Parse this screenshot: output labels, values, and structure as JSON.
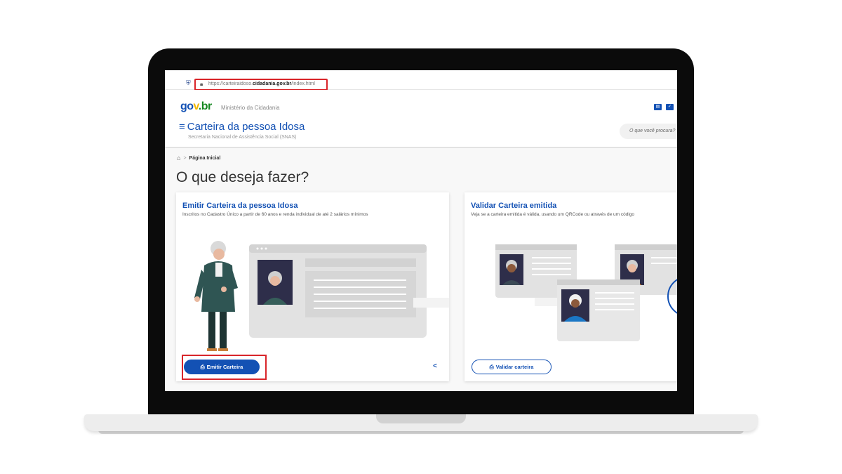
{
  "browser": {
    "url_prefix": "https://carteiraidoso.",
    "url_domain": "cidadania.gov.br",
    "url_suffix": "/index.html"
  },
  "header": {
    "logo": {
      "g": "go",
      "v": "v",
      "br": ".br"
    },
    "ministry": "Ministério da Cidadania",
    "site_title": "Carteira da pessoa Idosa",
    "site_subtitle": "Secretaria Nacional de Assistência Social (SNAS)",
    "search_placeholder": "O que você procura?"
  },
  "breadcrumb": {
    "separator": ">",
    "current": "Página Inicial"
  },
  "page_title": "O que deseja fazer?",
  "cards": [
    {
      "title": "Emitir Carteira da pessoa Idosa",
      "description": "Inscritos no Cadastro Único a partir de 60 anos e renda individual de até 2 salários mínimos",
      "button_label": "Emitir Carteira"
    },
    {
      "title": "Validar Carteira emitida",
      "description": "Veja se a carteira emitida é válida, usando um QRCode ou através de um código",
      "button_label": "Validar carteira"
    }
  ],
  "colors": {
    "primary_blue": "#1351b4",
    "highlight_red": "#d9252a"
  }
}
